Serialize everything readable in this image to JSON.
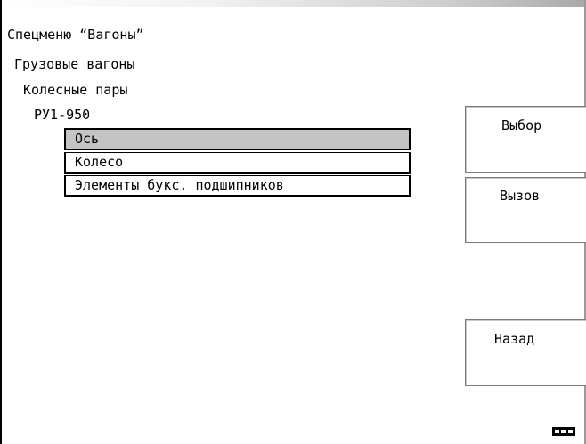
{
  "breadcrumbs": [
    "Спецменю “Вагоны”",
    "Грузовые вагоны",
    "Колесные пары",
    "РУ1-950"
  ],
  "menu": {
    "items": [
      {
        "label": "Ось",
        "selected": true
      },
      {
        "label": "Колесо",
        "selected": false
      },
      {
        "label": "Элементы букс. подшипников",
        "selected": false
      }
    ]
  },
  "soft_keys": {
    "select_label": "Выбор",
    "call_label": "Вызов",
    "back_label": "Назад"
  },
  "status": {
    "battery_icon": "battery-icon",
    "battery_level": 1.0
  },
  "colors": {
    "selected_item_bg": "#c4c4c4",
    "text": "#000000",
    "background": "#ffffff"
  }
}
